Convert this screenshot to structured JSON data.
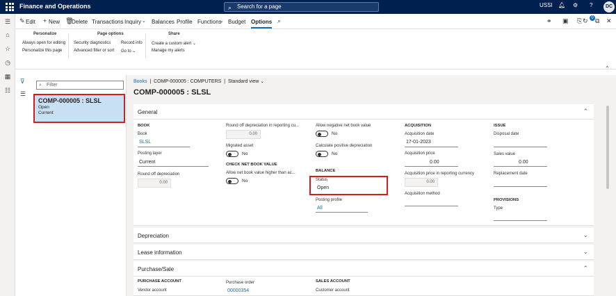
{
  "topbar": {
    "app_title": "Finance and Operations",
    "search_placeholder": "Search for a page",
    "company": "USSI",
    "user_initials": "DC"
  },
  "actionbar": {
    "items": [
      "Edit",
      "New",
      "Delete",
      "Transactions",
      "Inquiry",
      "Balances",
      "Profile",
      "Functions",
      "Budget",
      "Options"
    ],
    "active": "Options",
    "notification_count": "0"
  },
  "ribbon": {
    "groups": [
      {
        "title": "Personalize",
        "items": [
          "Always open for editing",
          "Personalize this page"
        ]
      },
      {
        "title": "Page options",
        "items": [
          "Security diagnostics",
          "Advanced filter or sort",
          "Record info",
          "Go to"
        ]
      },
      {
        "title": "Share",
        "items": [
          "Create a custom alert",
          "Manage my alerts"
        ]
      }
    ]
  },
  "list": {
    "filter_placeholder": "Filter",
    "item": {
      "title": "COMP-000005 : SLSL",
      "line1": "Open",
      "line2": "Current"
    }
  },
  "breadcrumb": {
    "link": "Books",
    "separator": "|",
    "record": "COMP-000005 : COMPUTERS",
    "view": "Standard view"
  },
  "page_title": "COMP-000005 : SLSL",
  "general": {
    "header": "General",
    "book_section": "BOOK",
    "book_label": "Book",
    "book_value": "SLSL",
    "posting_layer_label": "Posting layer",
    "posting_layer_value": "Current",
    "round_off_label": "Round off depreciation",
    "round_off_value": "0.00",
    "round_off_rep_label": "Round off depreciation in reporting cu...",
    "round_off_rep_value": "0.00",
    "migrated_label": "Migrated asset",
    "migrated_value": "No",
    "check_nbv_section": "CHECK NET BOOK VALUE",
    "allow_higher_label": "Allow net book value higher than ac...",
    "allow_higher_value": "No",
    "allow_negative_label": "Allow negative net book value",
    "allow_negative_value": "No",
    "calc_positive_label": "Calculate positive depreciation",
    "calc_positive_value": "No",
    "balance_section": "BALANCE",
    "status_label": "Status",
    "status_value": "Open",
    "posting_profile_label": "Posting profile",
    "posting_profile_value": "All",
    "acquisition_section": "ACQUISITION",
    "acq_date_label": "Acquisition date",
    "acq_date_value": "17-01-2023",
    "acq_price_label": "Acquisition price",
    "acq_price_value": "0.00",
    "acq_price_rep_label": "Acquisition price in reporting currency",
    "acq_price_rep_value": "0.00",
    "acq_method_label": "Acquisition method",
    "issue_section": "ISSUE",
    "disposal_date_label": "Disposal date",
    "sales_value_label": "Sales value",
    "sales_value_value": "0.00",
    "replacement_date_label": "Replacement date",
    "provisions_section": "PROVISIONS",
    "type_label": "Type"
  },
  "depreciation": {
    "header": "Depreciation"
  },
  "lease": {
    "header": "Lease information"
  },
  "purchase": {
    "header": "Purchase/Sale",
    "purchase_account_section": "PURCHASE ACCOUNT",
    "vendor_account_label": "Vendor account",
    "purchase_order_label": "Purchase order",
    "purchase_order_value": "00000354",
    "sales_account_section": "SALES ACCOUNT",
    "customer_account_label": "Customer account"
  },
  "colors": {
    "nav": "#002050",
    "accent": "#0f6cbd",
    "highlight": "#d41c1c",
    "selected": "#c7e0f4"
  }
}
